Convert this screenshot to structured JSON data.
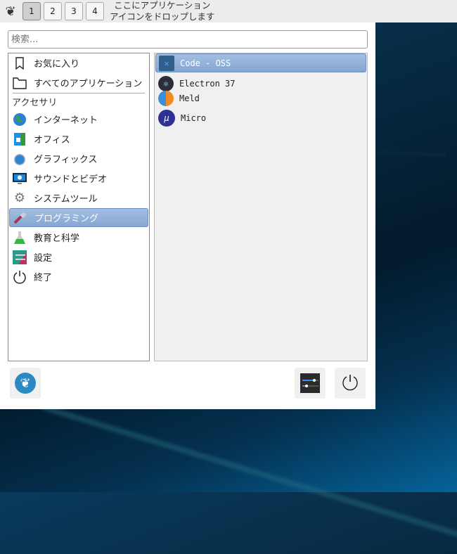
{
  "panel": {
    "workspaces": [
      "1",
      "2",
      "3",
      "4"
    ],
    "active_workspace": "1",
    "drop_hint_line1": "ここにアプリケーション",
    "drop_hint_line2": "アイコンをドロップします"
  },
  "search": {
    "placeholder": "検索..."
  },
  "categories": {
    "favorites": "お気に入り",
    "all_apps": "すべてのアプリケーション",
    "accessories": "アクセサリ",
    "items": [
      "インターネット",
      "オフィス",
      "グラフィックス",
      "サウンドとビデオ",
      "システムツール",
      "プログラミング",
      "教育と科学",
      "設定",
      "終了"
    ],
    "selected": "プログラミング"
  },
  "apps": [
    "Code - OSS",
    "Electron 37",
    "Meld",
    "Micro"
  ],
  "selected_app": "Code - OSS",
  "colors": {
    "selection": "#8fb0da",
    "panel": "#ececec",
    "accent": "#2a8ac4"
  }
}
